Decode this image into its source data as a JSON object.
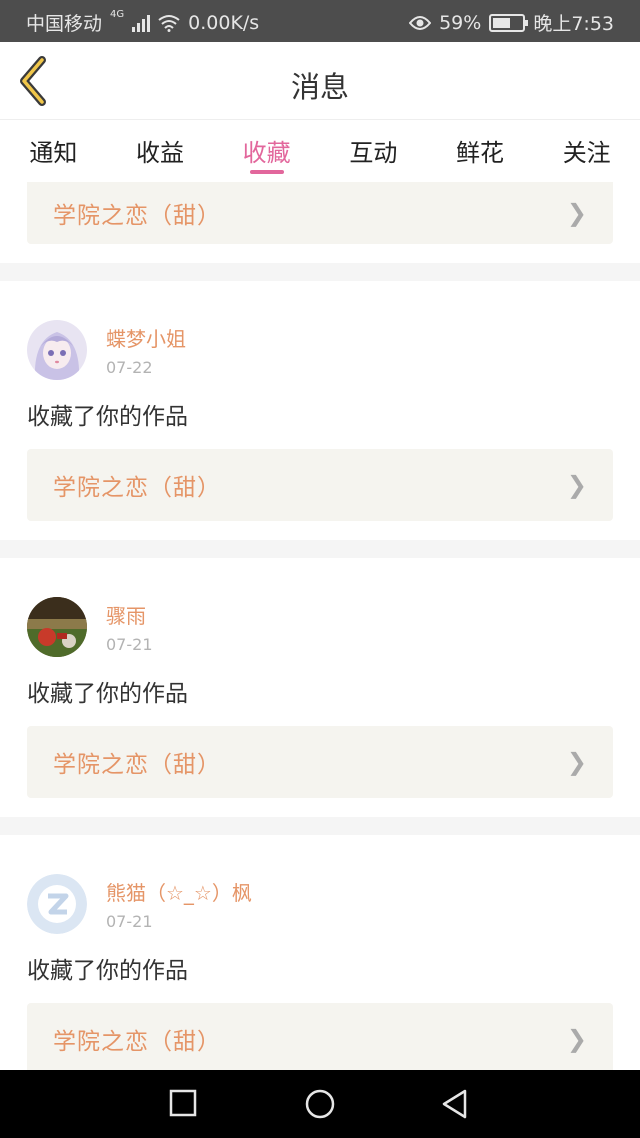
{
  "status_bar": {
    "carrier": "中国移动",
    "network": "4G",
    "speed": "0.00K/s",
    "battery": "59%",
    "battery_level": 0.59,
    "time": "晚上7:53"
  },
  "header": {
    "title": "消息"
  },
  "tabs": [
    {
      "label": "通知"
    },
    {
      "label": "收益"
    },
    {
      "label": "收藏"
    },
    {
      "label": "互动"
    },
    {
      "label": "鲜花"
    },
    {
      "label": "关注"
    }
  ],
  "active_tab": "收藏",
  "top_partial": {
    "work": "学院之恋（甜）"
  },
  "items": [
    {
      "user": "蝶梦小姐",
      "date": "07-22",
      "action": "收藏了你的作品",
      "work": "学院之恋（甜）"
    },
    {
      "user": "骤雨",
      "date": "07-21",
      "action": "收藏了你的作品",
      "work": "学院之恋（甜）"
    },
    {
      "user": "熊猫（☆_☆）枫",
      "date": "07-21",
      "action": "收藏了你的作品",
      "work": "学院之恋（甜）"
    }
  ],
  "colors": {
    "accent": "#e2679c",
    "name": "#e59567",
    "status_bar": "#4d4d4d"
  },
  "icons": [
    "back-chevron-icon",
    "chevron-right-icon",
    "home-circle-icon",
    "recent-square-icon",
    "back-triangle-icon"
  ]
}
